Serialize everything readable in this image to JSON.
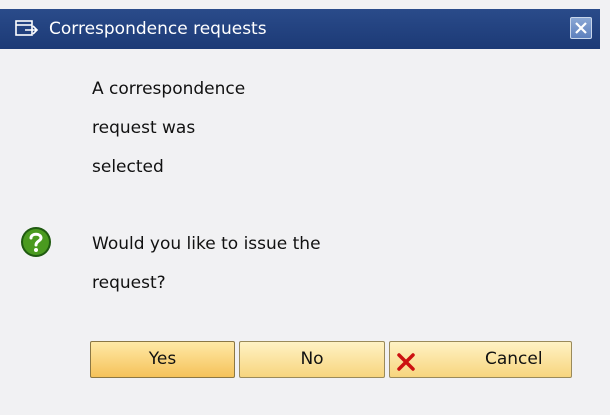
{
  "dialog": {
    "title": "Correspondence requests",
    "message_lines": [
      "A correspondence",
      "request was",
      "selected"
    ],
    "question_lines": [
      "Would you like to issue the",
      "request?"
    ],
    "icons": {
      "title": "window-icon",
      "close": "close-icon",
      "question": "question-icon",
      "cancel": "cancel-x-icon"
    }
  },
  "buttons": {
    "yes": "Yes",
    "no": "No",
    "cancel": "Cancel"
  },
  "colors": {
    "titlebar": "#1c3a76",
    "question_icon": "#4a9a1f",
    "cancel_x": "#cc1111",
    "button_fill": "#f7d57e"
  }
}
